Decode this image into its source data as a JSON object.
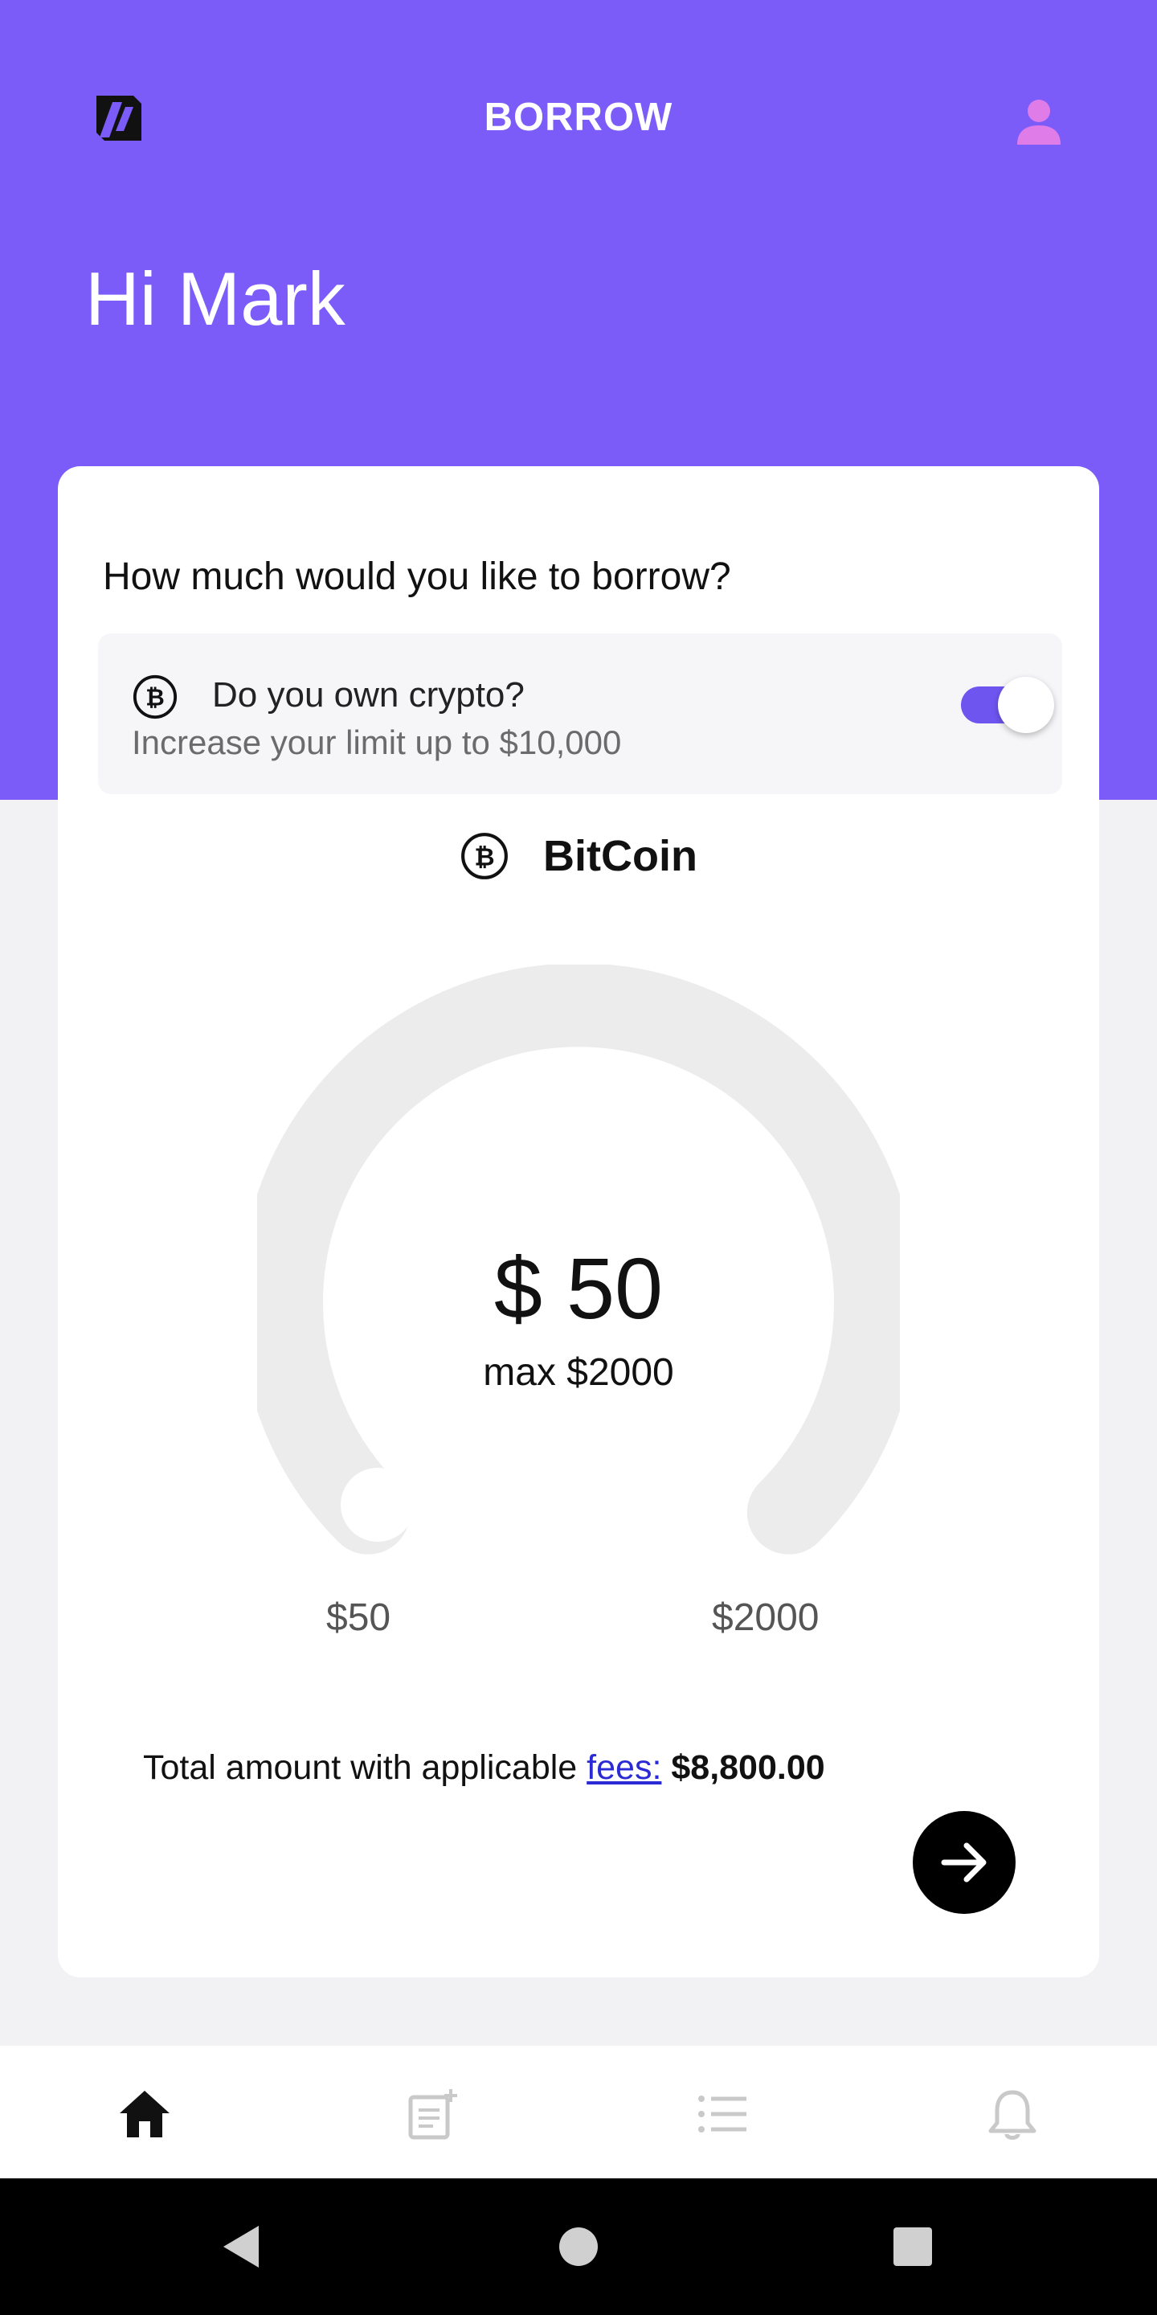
{
  "header": {
    "title": "BORROW",
    "greeting": "Hi Mark",
    "icons": {
      "logo": "app-logo-icon",
      "profile": "user-profile-icon"
    }
  },
  "colors": {
    "brand": "#7b5cf9",
    "profile_icon": "#e07ce8",
    "toggle_on": "#6e55f0",
    "gauge_track": "#ececec",
    "link": "#2b2bd6"
  },
  "card": {
    "question": "How much would you like to borrow?",
    "crypto": {
      "title": "Do you own crypto?",
      "subtitle": "Increase your limit up to $10,000",
      "toggle_on": true,
      "icon": "bitcoin-icon"
    },
    "coin": {
      "name": "BitCoin",
      "icon": "bitcoin-icon"
    },
    "slider": {
      "amount": "$ 50",
      "max_text": "max $2000",
      "min_label": "$50",
      "max_label": "$2000",
      "value_fraction": 0
    },
    "total": {
      "prefix": "Total amount with applicable",
      "link": "fees:",
      "value": "$8,800.00"
    },
    "next_icon": "arrow-right-icon"
  },
  "tabbar": {
    "items": [
      {
        "icon": "home-icon",
        "active": true
      },
      {
        "icon": "new-note-icon",
        "active": false
      },
      {
        "icon": "list-icon",
        "active": false
      },
      {
        "icon": "bell-icon",
        "active": false
      }
    ]
  },
  "system_nav": {
    "icons": [
      "back-icon",
      "home-circle-icon",
      "recents-icon"
    ]
  }
}
